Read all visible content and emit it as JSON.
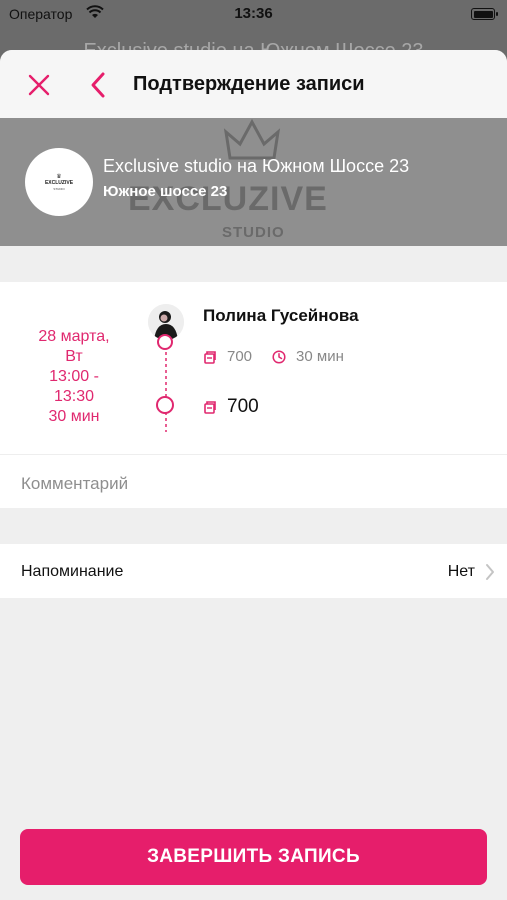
{
  "status_bar": {
    "carrier": "Оператор",
    "time": "13:36"
  },
  "background_title": "Exclusive studio на Южном Шоссе 23",
  "header": {
    "title": "Подтверждение записи"
  },
  "salon": {
    "name": "Exclusive studio на Южном Шоссе 23",
    "address": "Южное шоссе 23",
    "watermark": "EXCLUZIVE",
    "watermark_sub": "STUDIO",
    "logo_text": "EXCLUZIVE",
    "logo_sub": "STUDIO"
  },
  "appointment": {
    "date": "28 марта,",
    "weekday": "Вт",
    "time_range_start": "13:00 -",
    "time_range_end": "13:30",
    "duration": "30 мин",
    "master_name": "Полина Гусейнова",
    "service_price": "700",
    "service_duration": "30 мин",
    "total": "700"
  },
  "comment": {
    "placeholder": "Комментарий"
  },
  "reminder": {
    "label": "Напоминание",
    "value": "Нет"
  },
  "finish_button": {
    "label": "ЗАВЕРШИТЬ ЗАПИСЬ"
  },
  "colors": {
    "accent": "#e61e6b",
    "date_text": "#e0286f"
  }
}
